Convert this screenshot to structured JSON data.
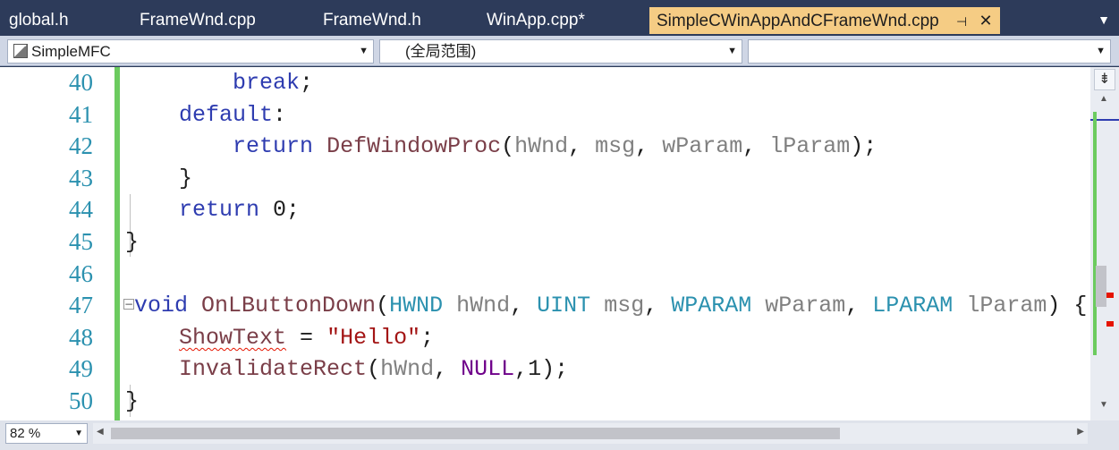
{
  "tabs": [
    {
      "label": "global.h",
      "active": false
    },
    {
      "label": "FrameWnd.cpp",
      "active": false
    },
    {
      "label": "FrameWnd.h",
      "active": false
    },
    {
      "label": "WinApp.cpp*",
      "active": false
    },
    {
      "label": "SimpleCWinAppAndCFrameWnd.cpp",
      "active": true
    }
  ],
  "tab_icons": {
    "pin": "pin-icon",
    "close": "close-icon",
    "overflow": "chevron-down-icon"
  },
  "navbar": {
    "project": "SimpleMFC",
    "scope": "(全局范围)",
    "member": ""
  },
  "editor": {
    "line_numbers": [
      "40",
      "41",
      "42",
      "43",
      "44",
      "45",
      "46",
      "47",
      "48",
      "49",
      "50"
    ],
    "lines": [
      "        break;",
      "    default:",
      "        return DefWindowProc(hWnd, msg, wParam, lParam);",
      "    }",
      "    return 0;",
      "}",
      "",
      "void OnLButtonDown(HWND hWnd, UINT msg, WPARAM wParam, LPARAM lParam) {",
      "    ShowText = \"Hello\";",
      "    InvalidateRect(hWnd, NULL,1);",
      "}"
    ]
  },
  "zoom": "82 %",
  "colors": {
    "keyword": "#2e3cb0",
    "function": "#7a3e48",
    "type": "#2b91af",
    "parameter": "#808080",
    "string": "#a31515",
    "macro": "#6f008a",
    "active_tab": "#f5cc84",
    "change_bar": "#6ccb5f"
  }
}
